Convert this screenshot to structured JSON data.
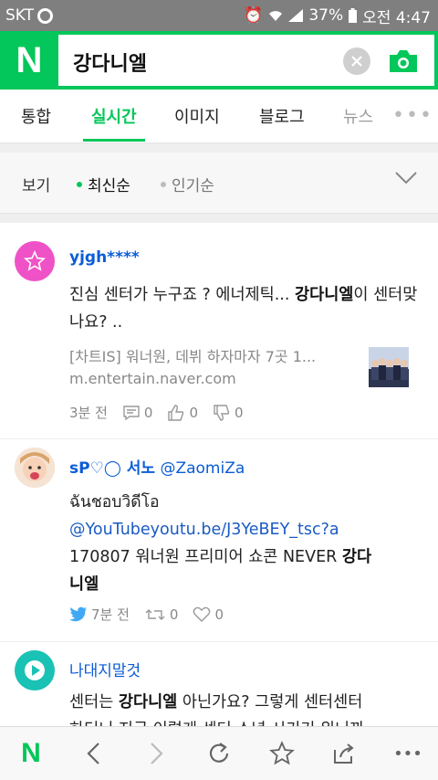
{
  "status_bar": {
    "carrier": "SKT",
    "battery": "37%",
    "time": "오전 4:47"
  },
  "header": {
    "logo": "N",
    "query": "강다니엘"
  },
  "tabs": [
    {
      "label": "통합"
    },
    {
      "label": "실시간"
    },
    {
      "label": "이미지"
    },
    {
      "label": "블로그"
    },
    {
      "label": "뉴스"
    }
  ],
  "sort": {
    "label": "보기",
    "options": [
      "최신순",
      "인기순"
    ],
    "selected": "최신순"
  },
  "posts": [
    {
      "author": "yjgh****",
      "text_before": "진심 센터가 누구죠 ? 에너제틱... ",
      "highlight": "강다니엘",
      "text_after": "이 센터맞나요? ..",
      "link_title": "[차트IS] 워너원, 데뷔 하자마자 7곳 1...",
      "link_url": "m.entertain.naver.com",
      "time": "3분 전",
      "comments": "0",
      "likes": "0",
      "dislikes": "0"
    },
    {
      "author": "sP♡◯ 서노",
      "handle": "@ZaomiZa",
      "line1": "ฉันชอบวิดีโอ",
      "link": "@YouTubeyoutu.be/J3YeBEY_tsc?a",
      "line3_before": "170807 워너원 프리미어 쇼콘 NEVER ",
      "highlight": "강다",
      "line4": "니엘",
      "time": "7분 전",
      "retweets": "0",
      "hearts": "0"
    },
    {
      "author": "나대지말것",
      "text_before": "센터는 ",
      "highlight": "강다니엘",
      "text_after": " 아닌가요? 그렇게 센터센터",
      "line2": "하더니 지금 이렇게 센터 소년 시키기 위니까"
    }
  ],
  "colors": {
    "naver_green": "#03c75a",
    "status_bar": "#7f7f7f",
    "link_blue": "#0b5cd6"
  }
}
